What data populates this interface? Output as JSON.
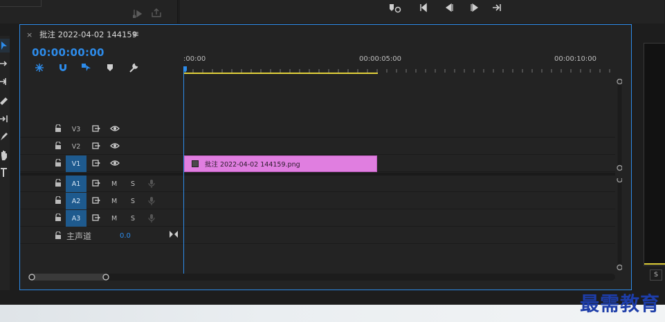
{
  "panel": {
    "close_glyph": "×",
    "sequence_title": "批注 2022-04-02 144159",
    "menu_glyph": "≡",
    "timecode": "00:00:00:00"
  },
  "ruler": {
    "labels": [
      ":00:00",
      "00:00:05:00",
      "00:00:10:00"
    ]
  },
  "tracks": {
    "video": [
      {
        "name": "V3",
        "selected": false
      },
      {
        "name": "V2",
        "selected": false
      },
      {
        "name": "V1",
        "selected": true
      }
    ],
    "audio": [
      {
        "name": "A1",
        "selected": true,
        "m": "M",
        "s": "S"
      },
      {
        "name": "A2",
        "selected": true,
        "m": "M",
        "s": "S"
      },
      {
        "name": "A3",
        "selected": true,
        "m": "M",
        "s": "S"
      }
    ],
    "master": {
      "label": "主声道",
      "value": "0.0"
    }
  },
  "clip": {
    "label": "批注 2022-04-02  144159.png",
    "color": "#e07ee0"
  },
  "right_panel": {
    "s_button": "S"
  },
  "watermark": "最需教育",
  "colors": {
    "accent": "#2d8ceb",
    "selected_track": "#1e5a8e",
    "work_area": "#e2d23b"
  }
}
